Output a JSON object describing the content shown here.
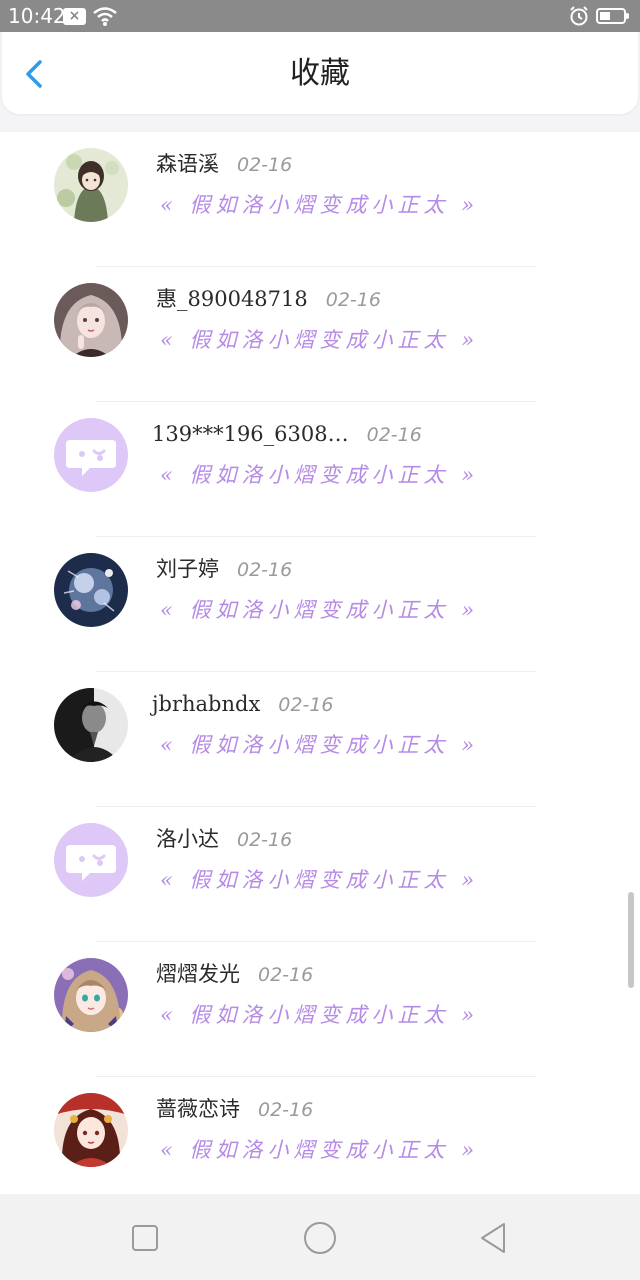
{
  "status_bar": {
    "time": "10:42",
    "notification_icon": "close-box-icon",
    "wifi_icon": "wifi-icon",
    "alarm_icon": "alarm-icon",
    "battery_icon": "battery-icon"
  },
  "header": {
    "title": "收藏",
    "back_icon": "chevron-left-icon"
  },
  "accent_color": "#b58be6",
  "back_color": "#2e9be8",
  "favorites": [
    {
      "name": "森语溪",
      "date": "02-16",
      "work": "« 假如洛小熠变成小正太 »",
      "avatar": "anime-girl-green"
    },
    {
      "name": "惠_890048718",
      "date": "02-16",
      "work": "« 假如洛小熠变成小正太 »",
      "avatar": "anime-girl-pink"
    },
    {
      "name": "139***196_6308…",
      "date": "02-16",
      "work": "« 假如洛小熠变成小正太 »",
      "avatar": "default-chat-bubble"
    },
    {
      "name": "刘子婷",
      "date": "02-16",
      "work": "« 假如洛小熠变成小正太 »",
      "avatar": "crystal-art"
    },
    {
      "name": "jbrhabndx",
      "date": "02-16",
      "work": "« 假如洛小熠变成小正太 »",
      "avatar": "bw-portrait"
    },
    {
      "name": "洛小达",
      "date": "02-16",
      "work": "« 假如洛小熠变成小正太 »",
      "avatar": "default-chat-bubble"
    },
    {
      "name": "熠熠发光",
      "date": "02-16",
      "work": "« 假如洛小熠变成小正太 »",
      "avatar": "anime-girl-purple"
    },
    {
      "name": "蔷薇恋诗",
      "date": "02-16",
      "work": "« 假如洛小熠变成小正太 »",
      "avatar": "anime-girl-red"
    }
  ],
  "nav_bar": {
    "recents_icon": "square-icon",
    "home_icon": "circle-icon",
    "back_icon": "triangle-back-icon"
  }
}
